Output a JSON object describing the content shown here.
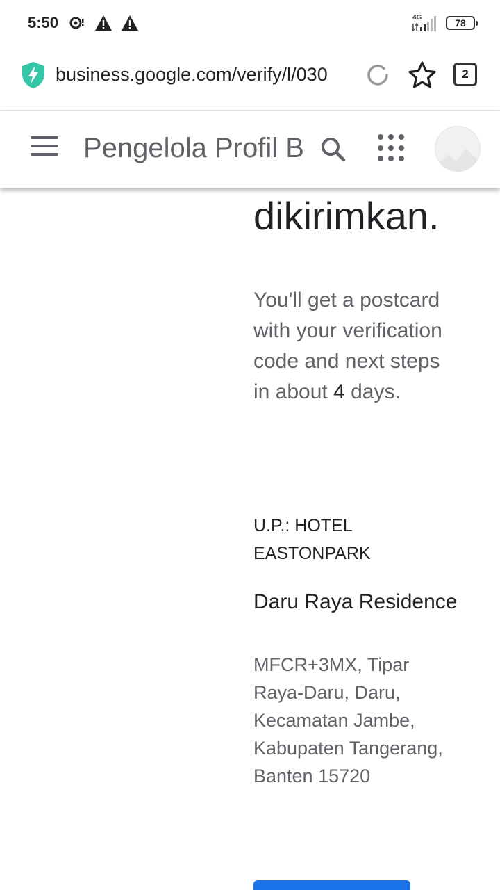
{
  "status_bar": {
    "time": "5:50",
    "network": "4G",
    "battery": "78",
    "icons": [
      "data-saver-icon",
      "warning-icon",
      "warning-icon",
      "signal-icon",
      "battery-icon"
    ]
  },
  "browser": {
    "url": "business.google.com/verify/l/030",
    "tab_count": "2",
    "icons": [
      "secure-shield-icon",
      "reload-icon",
      "bookmark-star-icon",
      "tabs-icon"
    ]
  },
  "header": {
    "title": "Pengelola Profil Bisnis",
    "icons": [
      "menu-icon",
      "search-icon",
      "apps-grid-icon",
      "avatar"
    ]
  },
  "main": {
    "heading_tail": "dikirimkan.",
    "description_prefix": "You'll get a postcard with your verification code and next steps in about ",
    "description_days": "4",
    "description_suffix": " days.",
    "recipient": "U.P.: HOTEL EASTONPARK",
    "business_name": "Daru Raya Residence",
    "address": "MFCR+3MX, Tipar Raya-Daru, Daru, Kecamatan Jambe, Kabupaten Tangerang, Banten 15720"
  },
  "colors": {
    "primary": "#1a73e8",
    "shield": "#35c6a8",
    "text_primary": "#202124",
    "text_secondary": "#5f6368"
  }
}
